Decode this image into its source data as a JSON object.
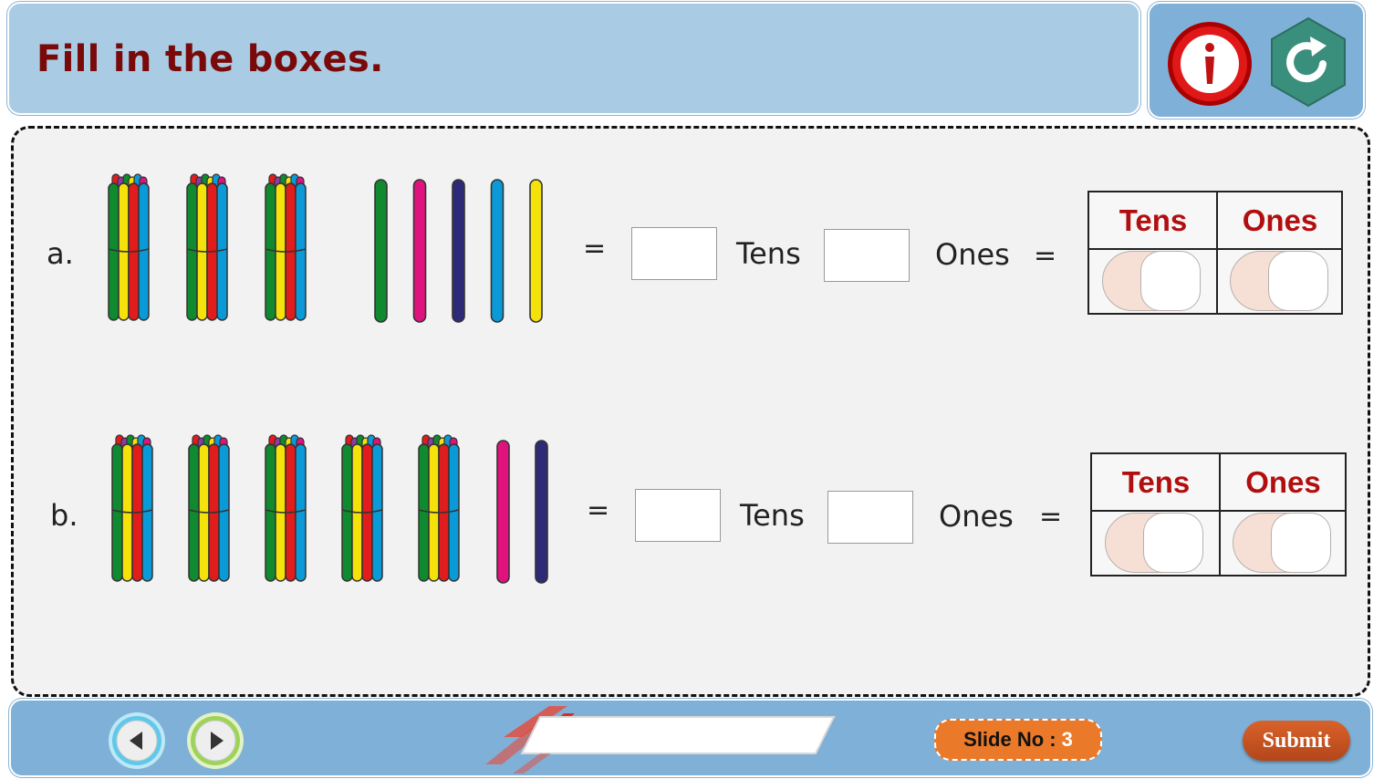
{
  "header": {
    "title": "Fill in the boxes."
  },
  "toolbar": {
    "info_icon": "info-icon",
    "reset_icon": "reload-icon"
  },
  "questions": [
    {
      "label": "a.",
      "bundles": 3,
      "loose_sticks": [
        "#0f8a2e",
        "#e0137e",
        "#2e2a78",
        "#0b9ad8",
        "#f5e20a"
      ],
      "equals": "=",
      "tens_word": "Tens",
      "ones_word": "Ones",
      "equals2": "=",
      "table": {
        "tens_header": "Tens",
        "ones_header": "Ones"
      }
    },
    {
      "label": "b.",
      "bundles": 5,
      "loose_sticks": [
        "#e0137e",
        "#2e2a78"
      ],
      "equals": "=",
      "tens_word": "Tens",
      "ones_word": "Ones",
      "equals2": "=",
      "table": {
        "tens_header": "Tens",
        "ones_header": "Ones"
      }
    }
  ],
  "bundle_colors": [
    "#0f8a2e",
    "#f5e20a",
    "#e01c1c",
    "#0b9ad8"
  ],
  "footer": {
    "prev_icon": "left-arrow-icon",
    "next_icon": "right-arrow-icon",
    "slide_label": "Slide No :",
    "slide_number": "3",
    "submit_label": "Submit"
  },
  "colors": {
    "title": "#7a0a0a",
    "header_bg": "#a9cbe4",
    "bar_bg": "#7fb1d8",
    "table_header": "#b10f0f",
    "slide_badge": "#ea7a2a",
    "submit": "#c4521f"
  }
}
